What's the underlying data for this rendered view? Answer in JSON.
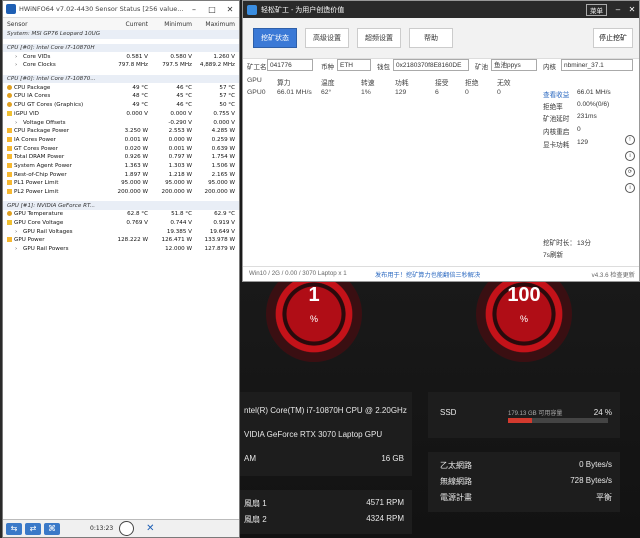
{
  "hwinfo": {
    "title": "HWiNFO64 v7.02-4430 Sensor Status [256 value...",
    "columns": {
      "sensor": "Sensor",
      "current": "Current",
      "minimum": "Minimum",
      "maximum": "Maximum"
    },
    "rows": [
      {
        "type": "group",
        "label": "System: MSI GP76 Leopard 10UG"
      },
      {
        "type": "spacer"
      },
      {
        "type": "group",
        "label": "CPU [#0]: Intel Core i7-10870H"
      },
      {
        "type": "row",
        "indent": 1,
        "icon": "exp",
        "label": "Core VIDs",
        "cur": "0.581 V",
        "min": "0.580 V",
        "max": "1.260 V"
      },
      {
        "type": "row",
        "indent": 1,
        "icon": "exp",
        "label": "Core Clocks",
        "cur": "797.8 MHz",
        "min": "797.5 MHz",
        "max": "4,889.2 MHz"
      },
      {
        "type": "spacer"
      },
      {
        "type": "group",
        "label": "CPU [#0]: Intel Core i7-10870..."
      },
      {
        "type": "row",
        "indent": 0,
        "icon": "temp",
        "label": "CPU Package",
        "cur": "49 °C",
        "min": "46 °C",
        "max": "57 °C"
      },
      {
        "type": "row",
        "indent": 0,
        "icon": "temp",
        "label": "CPU IA Cores",
        "cur": "48 °C",
        "min": "45 °C",
        "max": "57 °C"
      },
      {
        "type": "row",
        "indent": 0,
        "icon": "temp",
        "label": "CPU GT Cores (Graphics)",
        "cur": "49 °C",
        "min": "46 °C",
        "max": "50 °C"
      },
      {
        "type": "row",
        "indent": 0,
        "icon": "volt",
        "label": "iGPU VID",
        "cur": "0.000 V",
        "min": "0.000 V",
        "max": "0.755 V"
      },
      {
        "type": "row",
        "indent": 1,
        "icon": "exp",
        "label": "Voltage Offsets",
        "cur": "",
        "min": "-0.290 V",
        "max": "0.000 V"
      },
      {
        "type": "row",
        "indent": 0,
        "icon": "power",
        "label": "CPU Package Power",
        "cur": "3.250 W",
        "min": "2.553 W",
        "max": "4.285 W"
      },
      {
        "type": "row",
        "indent": 0,
        "icon": "power",
        "label": "IA Cores Power",
        "cur": "0.001 W",
        "min": "0.000 W",
        "max": "0.259 W"
      },
      {
        "type": "row",
        "indent": 0,
        "icon": "power",
        "label": "GT Cores Power",
        "cur": "0.020 W",
        "min": "0.001 W",
        "max": "0.639 W"
      },
      {
        "type": "row",
        "indent": 0,
        "icon": "power",
        "label": "Total DRAM Power",
        "cur": "0.926 W",
        "min": "0.797 W",
        "max": "1.754 W"
      },
      {
        "type": "row",
        "indent": 0,
        "icon": "power",
        "label": "System Agent Power",
        "cur": "1.363 W",
        "min": "1.303 W",
        "max": "1.506 W"
      },
      {
        "type": "row",
        "indent": 0,
        "icon": "power",
        "label": "Rest-of-Chip Power",
        "cur": "1.897 W",
        "min": "1.218 W",
        "max": "2.165 W"
      },
      {
        "type": "row",
        "indent": 0,
        "icon": "power",
        "label": "PL1 Power Limit",
        "cur": "95.000 W",
        "min": "95.000 W",
        "max": "95.000 W"
      },
      {
        "type": "row",
        "indent": 0,
        "icon": "power",
        "label": "PL2 Power Limit",
        "cur": "200.000 W",
        "min": "200.000 W",
        "max": "200.000 W"
      },
      {
        "type": "spacer"
      },
      {
        "type": "group",
        "label": "GPU [#1]: NVIDIA GeForce RT..."
      },
      {
        "type": "row",
        "indent": 0,
        "icon": "temp",
        "label": "GPU Temperature",
        "cur": "62.8 °C",
        "min": "51.8 °C",
        "max": "62.9 °C"
      },
      {
        "type": "row",
        "indent": 0,
        "icon": "volt",
        "label": "GPU Core Voltage",
        "cur": "0.769 V",
        "min": "0.744 V",
        "max": "0.919 V"
      },
      {
        "type": "row",
        "indent": 1,
        "icon": "exp",
        "label": "GPU Rail Voltages",
        "cur": "",
        "min": "19.385 V",
        "max": "19.649 V"
      },
      {
        "type": "row",
        "indent": 0,
        "icon": "power",
        "label": "GPU Power",
        "cur": "128.222 W",
        "min": "126.471 W",
        "max": "133.978 W"
      },
      {
        "type": "row",
        "indent": 1,
        "icon": "exp",
        "label": "GPU Rail Powers",
        "cur": "",
        "min": "12.000 W",
        "max": "127.879 W"
      }
    ],
    "status": {
      "time": "0:13:23"
    }
  },
  "miner": {
    "title": "轻松矿工 - 为用户创造价值",
    "menu": "菜单",
    "tabs": [
      "挖矿状态",
      "高级设置",
      "超频设置",
      "帮助"
    ],
    "stop": "停止挖矿",
    "config": {
      "worker_label": "矿工名",
      "worker": "041776",
      "coin_label": "币种",
      "coin": "ETH",
      "wallet_label": "钱包",
      "wallet": "0x2180370f8E8160DE",
      "pool_label": "矿池",
      "pool": "鱼池ppys",
      "kernel_label": "内核",
      "kernel": "nbminer_37.1"
    },
    "gpu_table": {
      "headers": [
        "GPU",
        "算力",
        "温度",
        "转速",
        "功耗",
        "接受",
        "拒绝",
        "无效"
      ],
      "rows": [
        [
          "GPU0",
          "66.01 MH/s",
          "62°",
          "1%",
          "129",
          "6",
          "0",
          "0"
        ]
      ]
    },
    "side": {
      "view_income": "查看收益",
      "hashrate": "66.01 MH/s",
      "reject_label": "拒绝率",
      "reject": "0.00%(0/6)",
      "latency_label": "矿池延时",
      "latency": "231ms",
      "core_restart_label": "内核重启",
      "core_restart": "0",
      "total_power_label": "显卡功耗",
      "total_power": "129",
      "mining_time_label": "挖矿时长：",
      "mining_time": "13分",
      "cycle": "7s刷新"
    },
    "footer": {
      "sys": "Win10 / 2G / 0.00 / 3070 Laptop x 1",
      "promo": "发布用于！挖矿算力也能翻倍三秒解决",
      "version": "v4.3.6 检查更新"
    }
  },
  "dashboard": {
    "gauge1": {
      "value": "1",
      "unit": "%"
    },
    "gauge2": {
      "value": "100",
      "unit": "%"
    },
    "cpu": "ntel(R) Core(TM) i7-10870H CPU @ 2.20GHz",
    "gpu": "VIDIA GeForce RTX 3070 Laptop GPU",
    "ram_label": "AM",
    "ram": "16 GB",
    "fan1_label": "風扇 1",
    "fan1": "4571 RPM",
    "fan2_label": "風扇 2",
    "fan2": "4324 RPM",
    "ssd_label": "SSD",
    "ssd_usage": "179.13 GB 可用容量",
    "ssd_pct": "24 %",
    "ssd_fraction": 0.24,
    "eth_label": "乙太網路",
    "eth": "0 Bytes/s",
    "wifi_label": "無線網路",
    "wifi": "728 Bytes/s",
    "power_label": "電源計畫",
    "power": "平衡"
  }
}
